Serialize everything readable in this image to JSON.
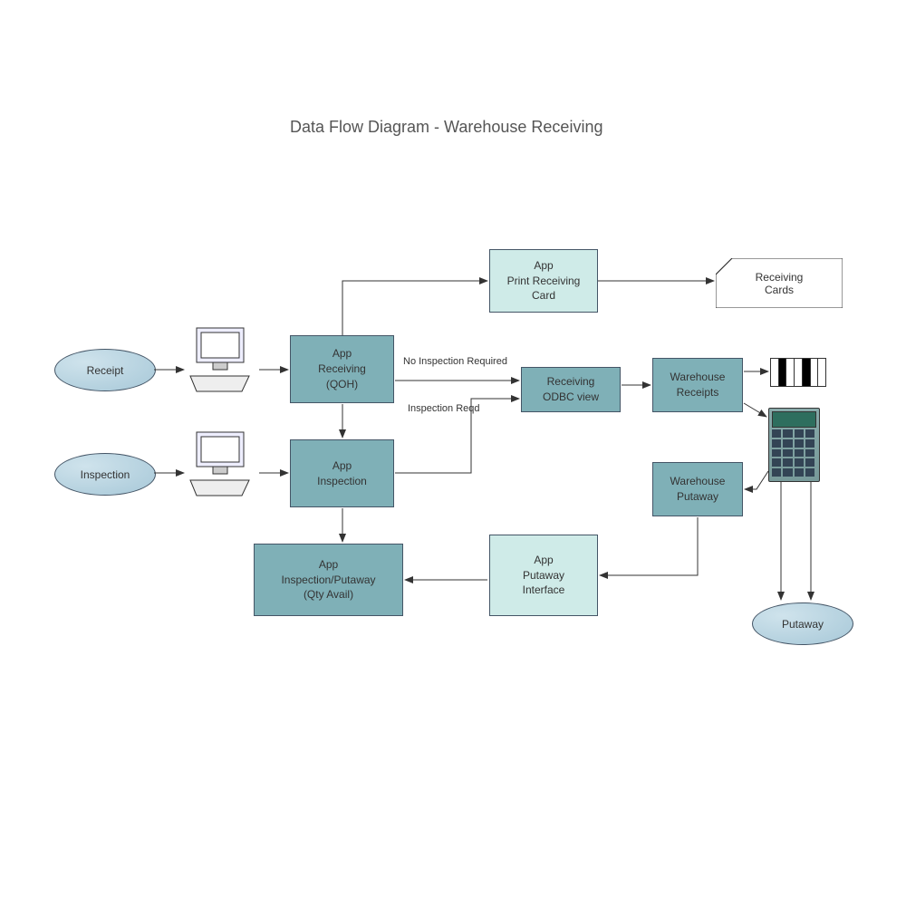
{
  "title": "Data Flow Diagram - Warehouse Receiving",
  "nodes": {
    "receipt": "Receipt",
    "inspection": "Inspection",
    "app_receiving": "App\nReceiving\n(QOH)",
    "app_inspection": "App\nInspection",
    "app_print": "App\nPrint Receiving\nCard",
    "receiving_odbc": "Receiving\nODBC view",
    "warehouse_receipts": "Warehouse\nReceipts",
    "warehouse_putaway": "Warehouse\nPutaway",
    "app_putaway_if": "App\nPutaway\nInterface",
    "app_insp_putaway": "App\nInspection/Putaway\n(Qty Avail)",
    "receiving_cards": "Receiving\nCards",
    "putaway": "Putaway"
  },
  "labels": {
    "no_inspection": "No Inspection Required",
    "inspection_reqd": "Inspection Reqd"
  }
}
